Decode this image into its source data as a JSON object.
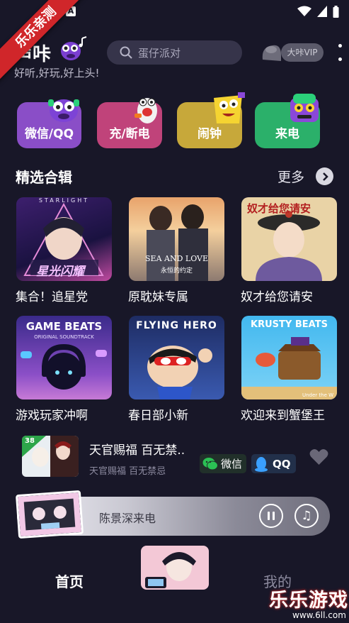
{
  "status_bar": {
    "a_badge": "A",
    "icons": [
      "wifi-icon",
      "signal-icon",
      "battery-icon"
    ]
  },
  "watermark": {
    "ribbon_text": "乐乐亲测",
    "brand_text": "乐乐游戏",
    "brand_url": "www.6ll.com"
  },
  "header": {
    "app_name": "声咔",
    "slogan": "好听,好玩,好上头!",
    "search_placeholder": "蛋仔派对",
    "vip_label": "大咔VIP"
  },
  "categories": [
    {
      "label": "微信/QQ",
      "color": "#8a4ec7"
    },
    {
      "label": "充/断电",
      "color": "#c0437a"
    },
    {
      "label": "闹钟",
      "color": "#c7a83a"
    },
    {
      "label": "来电",
      "color": "#2bb06a"
    }
  ],
  "section": {
    "title": "精选合辑",
    "more_label": "更多"
  },
  "albums": [
    {
      "label": "集合！追星党",
      "art_text": "星光闪耀",
      "art_top": "STARLIGHT"
    },
    {
      "label": "原耽妹专属",
      "art_text": "SEA AND LOVE",
      "art_sub": "永恒的约定"
    },
    {
      "label": "奴才给您请安",
      "art_text": "奴才给您请安"
    },
    {
      "label": "游戏玩家冲啊",
      "art_text": "GAME BEATS",
      "art_sub": "ORIGINAL SOUNDTRACK"
    },
    {
      "label": "春日部小新",
      "art_text": "FLYING HERO"
    },
    {
      "label": "欢迎来到蟹堡王",
      "art_text": "KRUSTY BEATS",
      "art_sub": "Under the W"
    }
  ],
  "now_playing_item": {
    "badge": "38",
    "title": "天官赐福 百无禁..",
    "subtitle": "天官赐福 百无禁忌",
    "share_wechat": "微信",
    "share_qq": "QQ"
  },
  "player": {
    "title": "陈景深来电"
  },
  "bottom_nav": {
    "home": "首页",
    "mine": "我的"
  }
}
